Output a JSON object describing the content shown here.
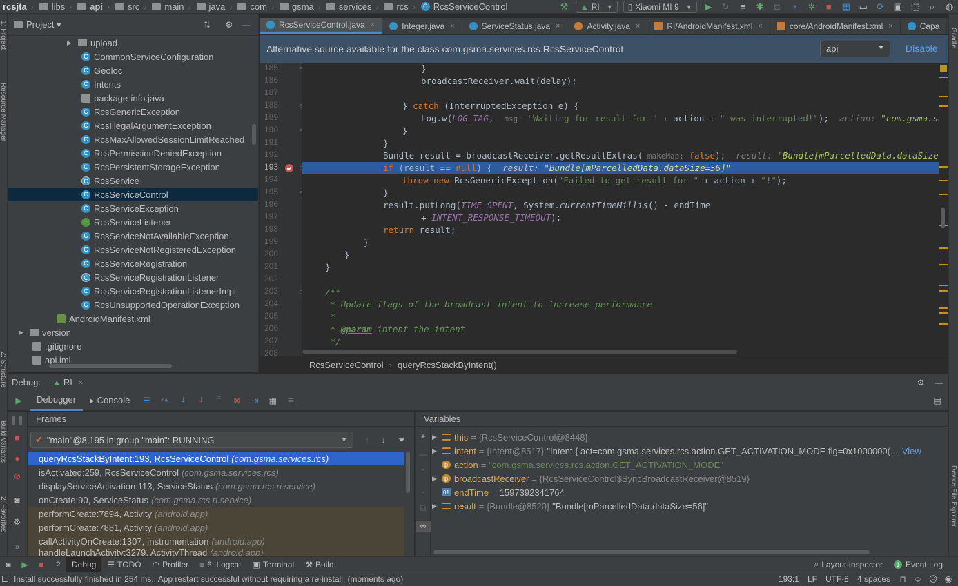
{
  "navbar": {
    "crumbs": [
      "rcsjta",
      "libs",
      "api",
      "src",
      "main",
      "java",
      "com",
      "gsma",
      "services",
      "rcs",
      "RcsServiceControl"
    ],
    "run_config": "RI",
    "device": "Xiaomi MI 9"
  },
  "project": {
    "title": "Project",
    "items": [
      {
        "label": "upload",
        "kind": "folder",
        "indent": 1
      },
      {
        "label": "CommonServiceConfiguration",
        "kind": "class"
      },
      {
        "label": "Geoloc",
        "kind": "class"
      },
      {
        "label": "Intents",
        "kind": "class"
      },
      {
        "label": "package-info.java",
        "kind": "file"
      },
      {
        "label": "RcsGenericException",
        "kind": "class"
      },
      {
        "label": "RcsIllegalArgumentException",
        "kind": "class"
      },
      {
        "label": "RcsMaxAllowedSessionLimitReached",
        "kind": "class"
      },
      {
        "label": "RcsPermissionDeniedException",
        "kind": "class"
      },
      {
        "label": "RcsPersistentStorageException",
        "kind": "class"
      },
      {
        "label": "RcsService",
        "kind": "class"
      },
      {
        "label": "RcsServiceControl",
        "kind": "class",
        "selected": true
      },
      {
        "label": "RcsServiceException",
        "kind": "class"
      },
      {
        "label": "RcsServiceListener",
        "kind": "interface"
      },
      {
        "label": "RcsServiceNotAvailableException",
        "kind": "class"
      },
      {
        "label": "RcsServiceNotRegisteredException",
        "kind": "class"
      },
      {
        "label": "RcsServiceRegistration",
        "kind": "class"
      },
      {
        "label": "RcsServiceRegistrationListener",
        "kind": "class"
      },
      {
        "label": "RcsServiceRegistrationListenerImpl",
        "kind": "class"
      },
      {
        "label": "RcsUnsupportedOperationException",
        "kind": "class"
      },
      {
        "label": "AndroidManifest.xml",
        "kind": "xml"
      },
      {
        "label": "version",
        "kind": "folder"
      },
      {
        "label": ".gitignore",
        "kind": "file"
      },
      {
        "label": "api.iml",
        "kind": "file"
      }
    ]
  },
  "tabs": [
    "RcsServiceControl.java",
    "Integer.java",
    "ServiceStatus.java",
    "Activity.java",
    "RI/AndroidManifest.xml",
    "core/AndroidManifest.xml",
    "Capa"
  ],
  "tabs_more": "⁴",
  "banner": {
    "text": "Alternative source available for the class com.gsma.services.rcs.RcsServiceControl",
    "select": "api",
    "disable": "Disable"
  },
  "line_numbers": [
    "185",
    "186",
    "187",
    "188",
    "189",
    "190",
    "191",
    "192",
    "193",
    "194",
    "195",
    "196",
    "197",
    "198",
    "199",
    "200",
    "201",
    "202",
    "203",
    "204",
    "205",
    "206",
    "207",
    "208"
  ],
  "code": {
    "l185": "}",
    "l186": "broadcastReceiver.wait(delay);",
    "l188_a": "} ",
    "l188_catch": "catch",
    "l188_b": " (InterruptedException e) {",
    "l189_a": "Log.",
    "l189_w": "w",
    "l189_b": "(",
    "l189_tag": "LOG_TAG",
    "l189_c": ",  ",
    "l189_hint": "msg:",
    "l189_s1": " \"Waiting for result for \"",
    "l189_d": " + action + ",
    "l189_s2": "\" was interrupted!\"",
    "l189_e": ");  ",
    "l189_dbg": "action:",
    "l189_dbgv": " \"com.gsma.services.rc",
    "l190": "}",
    "l191": "}",
    "l192_a": "Bundle result = broadcastReceiver.getResultExtras(",
    "l192_hint": " makeMap:",
    "l192_f": " false",
    "l192_b": ");  ",
    "l192_dbg": "result:",
    "l192_dbgv": " \"Bundle[mParcelledData.dataSize=56]\"",
    "l192_tail": "  bro",
    "l193_if": "if",
    "l193_a": " (result == ",
    "l193_null": "null",
    "l193_b": ") {  ",
    "l193_dbg": "result:",
    "l193_dbgv": " \"Bundle[mParcelledData.dataSize=56]\"",
    "l194_throw": "throw new",
    "l194_a": " RcsGenericException(",
    "l194_s": "\"Failed to get result for \"",
    "l194_b": " + action + ",
    "l194_s2": "\"!\"",
    "l194_c": ");",
    "l195": "}",
    "l196_a": "result.putLong(",
    "l196_c": "TIME_SPENT",
    "l196_b": ", System.",
    "l196_m": "currentTimeMillis",
    "l196_d": "() - endTime",
    "l197_a": "+ ",
    "l197_c": "INTENT_RESPONSE_TIMEOUT",
    "l197_b": ");",
    "l198_ret": "return",
    "l198_a": " result;",
    "l199": "}",
    "l200": "}",
    "l201": "}",
    "l203": "/**",
    "l204": " * Update flags of the broadcast intent to increase performance",
    "l205": " *",
    "l206_a": " * ",
    "l206_tag": "@param",
    "l206_b": " intent the intent",
    "l207": " */"
  },
  "editor_breadcrumb": [
    "RcsServiceControl",
    "queryRcsStackByIntent()"
  ],
  "debug": {
    "label": "Debug:",
    "config": "RI",
    "tabs": [
      "Debugger",
      "Console"
    ],
    "frames_title": "Frames",
    "variables_title": "Variables",
    "thread": "\"main\"@8,195 in group \"main\": RUNNING",
    "frames": [
      {
        "method": "queryRcsStackByIntent:193, RcsServiceControl",
        "pkg": "(com.gsma.services.rcs)",
        "selected": true
      },
      {
        "method": "isActivated:259, RcsServiceControl",
        "pkg": "(com.gsma.services.rcs)"
      },
      {
        "method": "displayServiceActivation:113, ServiceStatus",
        "pkg": "(com.gsma.rcs.ri.service)"
      },
      {
        "method": "onCreate:90, ServiceStatus",
        "pkg": "(com.gsma.rcs.ri.service)"
      },
      {
        "method": "performCreate:7894, Activity",
        "pkg": "(android.app)",
        "lib": true
      },
      {
        "method": "performCreate:7881, Activity",
        "pkg": "(android.app)",
        "lib": true
      },
      {
        "method": "callActivityOnCreate:1307, Instrumentation",
        "pkg": "(android.app)",
        "lib": true
      },
      {
        "method": "handleLaunchActivity:3279, ActivityThread",
        "pkg": "(android.app)",
        "lib": true
      }
    ],
    "variables": [
      {
        "name": "this",
        "ref": "= {RcsServiceControl@8448}",
        "value": "",
        "icon": "field",
        "expand": true
      },
      {
        "name": "intent",
        "ref": "= {Intent@8517}",
        "value": "\"Intent { act=com.gsma.services.rcs.action.GET_ACTIVATION_MODE flg=0x1000000(...",
        "link": "View",
        "icon": "field",
        "expand": true
      },
      {
        "name": "action",
        "ref": "=",
        "value": "\"com.gsma.services.rcs.action.GET_ACTIVATION_MODE\"",
        "icon": "param",
        "expand": false,
        "str": true
      },
      {
        "name": "broadcastReceiver",
        "ref": "= {RcsServiceControl$SyncBroadcastReceiver@8519}",
        "value": "",
        "icon": "param",
        "expand": true
      },
      {
        "name": "endTime",
        "ref": "=",
        "value": "1597392341764",
        "icon": "num",
        "expand": false,
        "numeric": true
      },
      {
        "name": "result",
        "ref": "= {Bundle@8520}",
        "value": "\"Bundle[mParcelledData.dataSize=56]\"",
        "icon": "field",
        "expand": true
      }
    ]
  },
  "toolstrip": {
    "items": [
      "Debug",
      "TODO",
      "Profiler",
      "6: Logcat",
      "Terminal",
      "Build"
    ],
    "right": [
      "Layout Inspector",
      "Event Log"
    ],
    "event_count": "1"
  },
  "statusbar": {
    "message": "Install successfully finished in 254 ms.: App restart successful without requiring a re-install. (moments ago)",
    "position": "193:1",
    "line_sep": "LF",
    "encoding": "UTF-8",
    "indent": "4 spaces"
  },
  "side_labels": {
    "left_top": "1: Project",
    "left_mid": "Resource Manager",
    "left_structure": "Z: Structure",
    "left_build": "Build Variants",
    "left_fav": "2: Favorites",
    "right_top": "Gradle",
    "right_bottom": "Device File Explorer"
  },
  "colors": {
    "accent": "#4a88c7",
    "selection": "#2f65ca",
    "banner": "#3c5066",
    "breakpoint": "#c75450"
  }
}
